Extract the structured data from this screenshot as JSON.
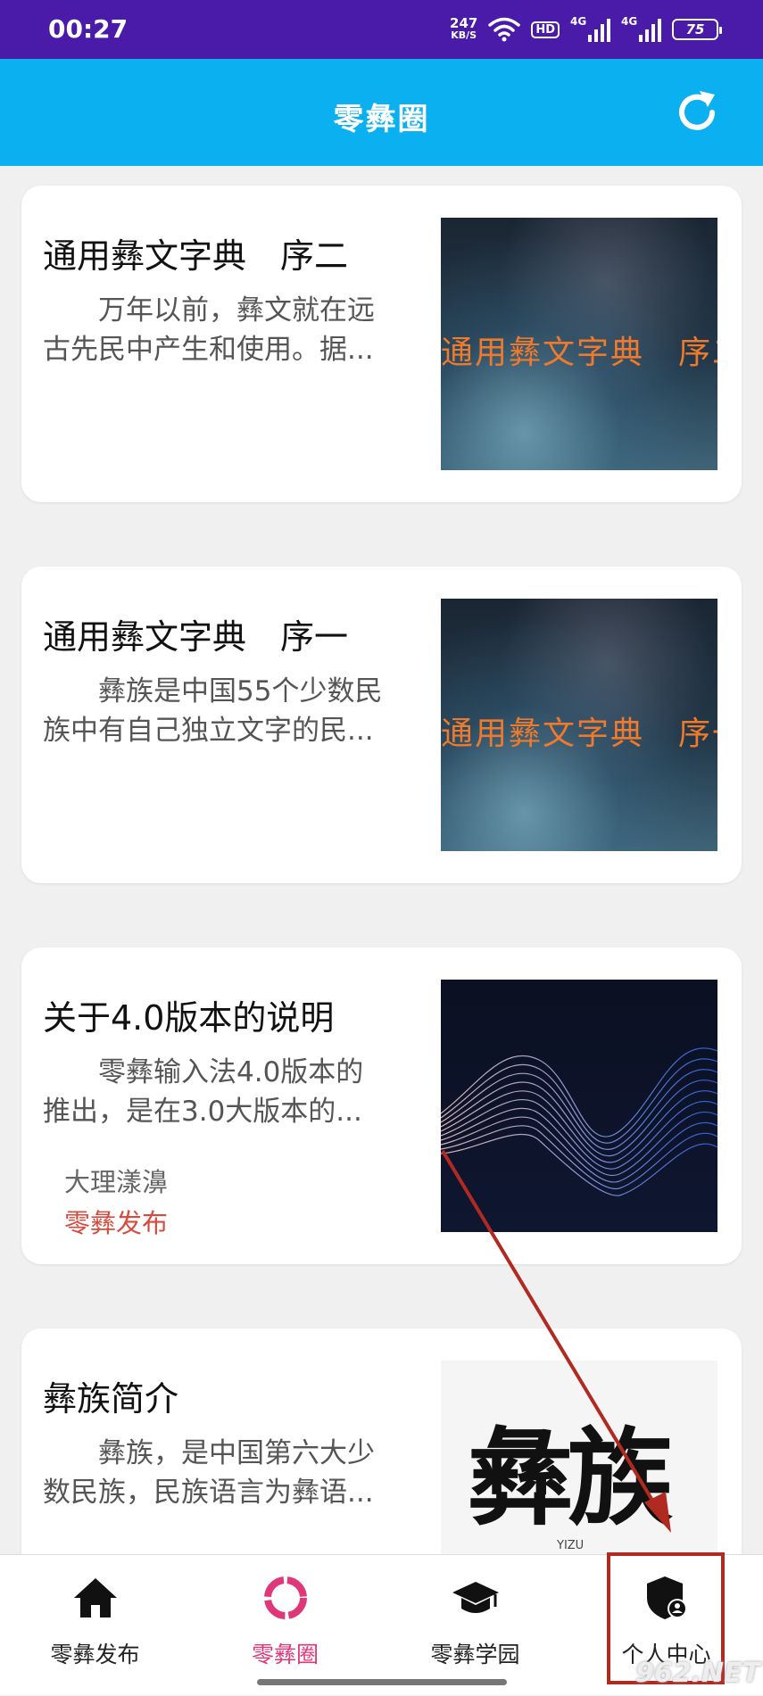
{
  "status_bar": {
    "time": "00:27",
    "net_speed": "247",
    "net_speed_unit": "KB/S",
    "hd_label": "HD",
    "signal_1": "4G",
    "signal_2": "4G",
    "battery": "75"
  },
  "app_bar": {
    "title": "零彝圈",
    "refresh_icon": "refresh-icon"
  },
  "cards": [
    {
      "title": "通用彝文字典　序二",
      "desc_line1": "　　万年以前，彝文就在远",
      "desc_line2": "古先民中产生和使用。据...",
      "thumb_text": "通用彝文字典　序二"
    },
    {
      "title": "通用彝文字典　序一",
      "desc_line1": "　　彝族是中国55个少数民",
      "desc_line2": "族中有自己独立文字的民...",
      "thumb_text": "通用彝文字典　序一"
    },
    {
      "title": "关于4.0版本的说明",
      "desc_line1": "　　零彝输入法4.0版本的",
      "desc_line2": "推出，是在3.0大版本的...",
      "author": "大理漾濞",
      "tag": "零彝发布"
    },
    {
      "title": "彝族简介",
      "desc_line1": "　　彝族，是中国第六大少",
      "desc_line2": "数民族，民族语言为彝语...",
      "thumb_text": "彝族",
      "thumb_subtext": "YIZU"
    }
  ],
  "tab_bar": {
    "tabs": [
      {
        "label": "零彝发布",
        "icon": "home-icon"
      },
      {
        "label": "零彝圈",
        "icon": "ring-icon"
      },
      {
        "label": "零彝学园",
        "icon": "graduation-cap-icon"
      },
      {
        "label": "个人中心",
        "icon": "user-shield-icon"
      }
    ],
    "active_index": 1
  },
  "watermark": "962.NET",
  "colors": {
    "status_bar": "#4a1aa8",
    "app_bar": "#0ab0ef",
    "active_tab": "#e0367a",
    "tag": "#d84a3c",
    "highlight": "#b12a22"
  }
}
